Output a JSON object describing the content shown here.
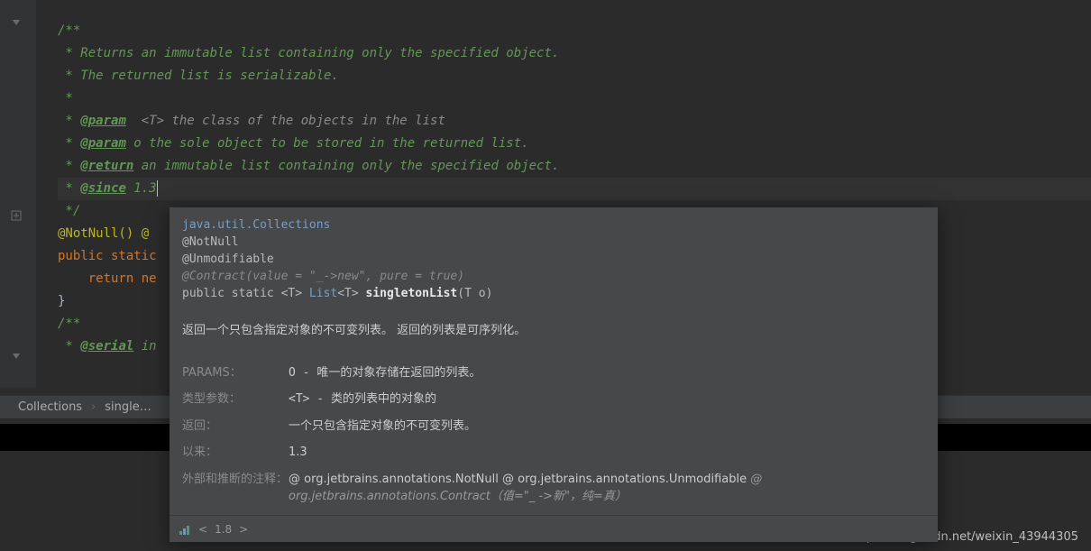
{
  "code": {
    "l1": "/**",
    "l2": " * Returns an immutable list containing only the specified object.",
    "l3": " * The returned list is serializable.",
    "l4": " *",
    "l5_pre": " * ",
    "l5_tag": "@param",
    "l5_rest": "  <T> the class of the objects in the list",
    "l6_pre": " * ",
    "l6_tag": "@param",
    "l6_rest": " o the sole object to be stored in the returned list.",
    "l7_pre": " * ",
    "l7_tag": "@return",
    "l7_rest": " an immutable list containing only the specified object.",
    "l8_pre": " * ",
    "l8_tag": "@since",
    "l8_rest": " 1.3",
    "l9": " */",
    "l10_a": "@NotNull()",
    "l10_b": " @",
    "l11_a": "public static",
    "l12_a": "    return ",
    "l12_b": "ne",
    "l13": "}",
    "l14": "",
    "l15": "/**",
    "l16_pre": " * ",
    "l16_tag": "@serial",
    "l16_rest": " in"
  },
  "popup": {
    "pkg": "java.util.Collections",
    "ann1": "@NotNull",
    "ann2": "@Unmodifiable",
    "contract": "@Contract(value = \"_->new\", pure = true)",
    "sig_pre": "public static <T> ",
    "sig_type": "List",
    "sig_post": "<T> ",
    "sig_method": "singletonList",
    "sig_args": "(T o)",
    "desc": "返回一个只包含指定对象的不可变列表。 返回的列表是可序列化。",
    "rows": [
      {
        "label": "PARAMS：",
        "value_pre": "O - ",
        "value": "唯一的对象存储在返回的列表。"
      },
      {
        "label": "类型参数：",
        "value_pre": "<T> - ",
        "value": "类的列表中的对象的"
      },
      {
        "label": "返回：",
        "value_pre": "",
        "value": "一个只包含指定对象的不可变列表。"
      },
      {
        "label": "以来：",
        "value_pre": "",
        "value": "1.3"
      }
    ],
    "ext_label": "外部和推断的注释：",
    "ext_a1": "@ org.jetbrains.annotations.NotNull",
    "ext_a2": "@ org.jetbrains.annotations.Unmodifiable",
    "ext_a3": "@ org.jetbrains.annotations.Contract（值=\"_ ->新\"，纯=真）",
    "footer_arrow": "<",
    "footer_ver": "1.8",
    "footer_arrow2": ">"
  },
  "breadcrumb": {
    "a": "Collections",
    "b": "single…"
  },
  "watermark": "https://blog.csdn.net/weixin_43944305"
}
